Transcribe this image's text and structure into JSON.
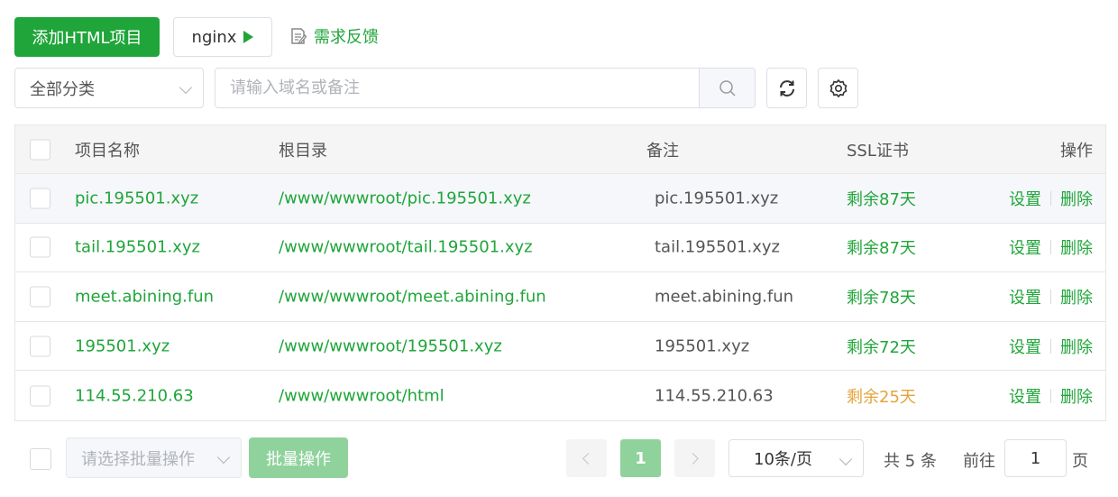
{
  "toolbar": {
    "add_label": "添加HTML项目",
    "nginx_label": "nginx",
    "feedback_label": "需求反馈"
  },
  "filter": {
    "category_value": "全部分类",
    "search_placeholder": "请输入域名或备注"
  },
  "table": {
    "headers": {
      "name": "项目名称",
      "root": "根目录",
      "note": "备注",
      "ssl": "SSL证书",
      "ops": "操作"
    },
    "rows": [
      {
        "name": "pic.195501.xyz",
        "root": "/www/wwwroot/pic.195501.xyz",
        "note": "pic.195501.xyz",
        "ssl": "剩余87天",
        "set": "设置",
        "del": "删除"
      },
      {
        "name": "tail.195501.xyz",
        "root": "/www/wwwroot/tail.195501.xyz",
        "note": "tail.195501.xyz",
        "ssl": "剩余87天",
        "set": "设置",
        "del": "删除"
      },
      {
        "name": "meet.abining.fun",
        "root": "/www/wwwroot/meet.abining.fun",
        "note": "meet.abining.fun",
        "ssl": "剩余78天",
        "set": "设置",
        "del": "删除"
      },
      {
        "name": "195501.xyz",
        "root": "/www/wwwroot/195501.xyz",
        "note": "195501.xyz",
        "ssl": "剩余72天",
        "set": "设置",
        "del": "删除"
      },
      {
        "name": "114.55.210.63",
        "root": "/www/wwwroot/html",
        "note": "114.55.210.63",
        "ssl": "剩余25天",
        "set": "设置",
        "del": "删除"
      }
    ]
  },
  "footer": {
    "batch_placeholder": "请选择批量操作",
    "batch_button": "批量操作",
    "current_page": "1",
    "page_size": "10条/页",
    "total": "共 5 条",
    "goto_label": "前往",
    "goto_value": "1",
    "page_suffix": "页"
  },
  "colors": {
    "accent": "#20a53a",
    "warning": "#e6a23c",
    "disabled_accent": "#90d29c"
  }
}
